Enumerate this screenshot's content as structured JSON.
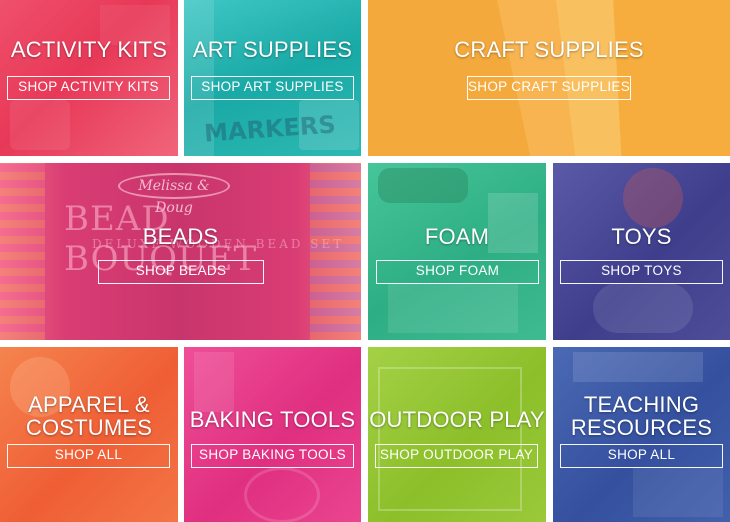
{
  "tiles": [
    {
      "id": "activity-kits",
      "title": "ACTIVITY KITS",
      "button": "SHOP ACTIVITY KITS",
      "tint": "#ee3f5c"
    },
    {
      "id": "art-supplies",
      "title": "ART SUPPLIES",
      "button": "SHOP ART SUPPLIES",
      "tint": "#1fb3b0"
    },
    {
      "id": "craft-supplies",
      "title": "CRAFT SUPPLIES",
      "button": "SHOP CRAFT SUPPLIES",
      "tint": "#f3a53a"
    },
    {
      "id": "beads",
      "title": "BEADS",
      "button": "SHOP BEADS",
      "tint": "#e4497a"
    },
    {
      "id": "foam",
      "title": "FOAM",
      "button": "SHOP FOAM",
      "tint": "#33b88a"
    },
    {
      "id": "toys",
      "title": "TOYS",
      "button": "SHOP TOYS",
      "tint": "#4a4a9a"
    },
    {
      "id": "apparel",
      "title_line1": "APPAREL &",
      "title_line2": "COSTUMES",
      "button": "SHOP ALL",
      "tint": "#f26a3d"
    },
    {
      "id": "baking-tools",
      "title": "BAKING TOOLS",
      "button": "SHOP BAKING TOOLS",
      "tint": "#e83c8c"
    },
    {
      "id": "outdoor-play",
      "title": "OUTDOOR PLAY",
      "button": "SHOP OUTDOOR PLAY",
      "tint": "#94c534"
    },
    {
      "id": "teaching",
      "title_line1": "TEACHING",
      "title_line2": "RESOURCES",
      "button": "SHOP ALL",
      "tint": "#3a58a8"
    }
  ],
  "product_text": {
    "markers": "MARKERS",
    "bead_brand": "Melissa & Doug",
    "bead_title": "BEAD BOUQUET",
    "bead_subtitle": "DELUXE WOODEN BEAD SET"
  }
}
